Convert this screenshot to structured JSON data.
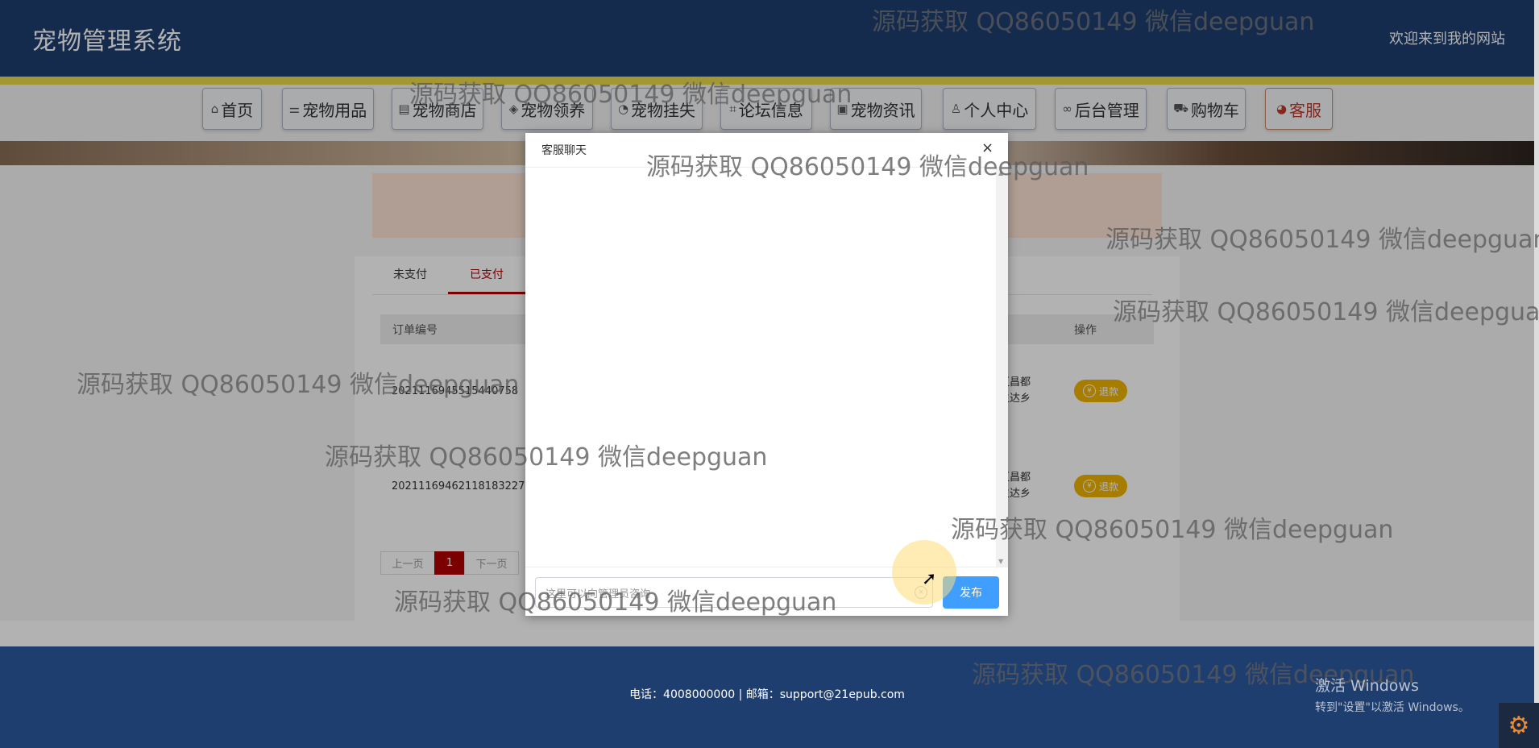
{
  "header": {
    "title": "宠物管理系统",
    "welcome": "欢迎来到我的网站"
  },
  "nav": [
    {
      "label": "首页",
      "icon": "home-icon",
      "glyph": "⌂"
    },
    {
      "label": "宠物用品",
      "icon": "sliders-icon",
      "glyph": "⚌"
    },
    {
      "label": "宠物商店",
      "icon": "shop-icon",
      "glyph": "▤"
    },
    {
      "label": "宠物领养",
      "icon": "box-icon",
      "glyph": "◈"
    },
    {
      "label": "宠物挂失",
      "icon": "dashboard-icon",
      "glyph": "◔"
    },
    {
      "label": "论坛信息",
      "icon": "tag-icon",
      "glyph": "⌗"
    },
    {
      "label": "宠物资讯",
      "icon": "news-icon",
      "glyph": "▣"
    },
    {
      "label": "个人中心",
      "icon": "user-icon",
      "glyph": "♙"
    },
    {
      "label": "后台管理",
      "icon": "link-icon",
      "glyph": "∞"
    },
    {
      "label": "购物车",
      "icon": "cart-icon",
      "glyph": "⛟"
    },
    {
      "label": "客服",
      "icon": "support-icon",
      "glyph": "◕"
    }
  ],
  "orders": {
    "tabs": [
      "未支付",
      "已支付"
    ],
    "active_tab": "已支付",
    "columns": {
      "order_no": "订单编号",
      "actions": "操作"
    },
    "rows": [
      {
        "order_no": "20211169455154407​58",
        "address_line1": "区昌都",
        "address_line2": "生达乡",
        "action": "退款"
      },
      {
        "order_no": "20211169462118183227",
        "address_line1": "区昌都",
        "address_line2": "生达乡",
        "action": "退款"
      }
    ],
    "pager": {
      "prev": "上一页",
      "current": "1",
      "next": "下一页"
    }
  },
  "dialog": {
    "title": "客服聊天",
    "close_glyph": "×",
    "input_value": "这里可以向管理员咨询",
    "send_label": "发布"
  },
  "footer": {
    "contact": "电话：4008000000 | 邮箱：support@21epub.com"
  },
  "watermark": {
    "text": "源码获取 QQ86050149 微信deepguan",
    "instances": [
      "w1",
      "w2",
      "w3",
      "w4",
      "w5",
      "w6",
      "w7",
      "w8",
      "w9",
      "w10"
    ]
  },
  "system": {
    "activate_title": "激活 Windows",
    "activate_hint": "转到\"设置\"以激活 Windows。"
  },
  "colors": {
    "header_bg": "#1f3e70",
    "accent_red": "#b00000",
    "send_blue": "#409eff",
    "refund_yellow": "#f0b400"
  }
}
